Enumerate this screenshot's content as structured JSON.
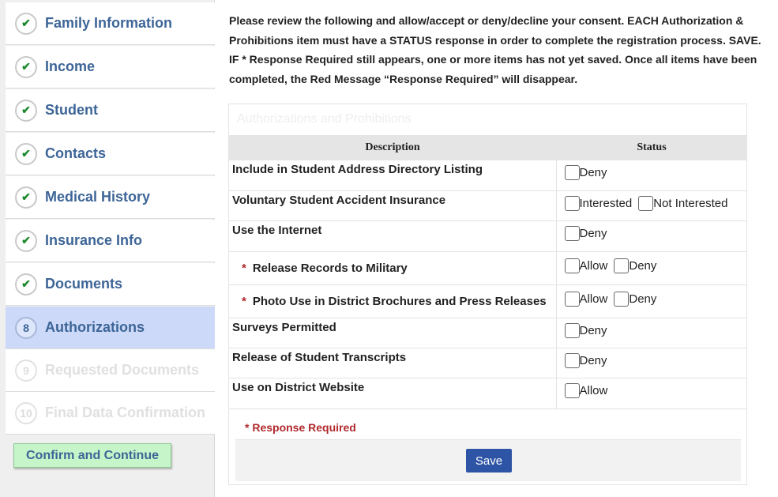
{
  "sidebar": {
    "steps": [
      {
        "marker": "✔",
        "label": "Family Information",
        "state": "complete"
      },
      {
        "marker": "✔",
        "label": "Income",
        "state": "complete"
      },
      {
        "marker": "✔",
        "label": "Student",
        "state": "complete"
      },
      {
        "marker": "✔",
        "label": "Contacts",
        "state": "complete"
      },
      {
        "marker": "✔",
        "label": "Medical History",
        "state": "complete"
      },
      {
        "marker": "✔",
        "label": "Insurance Info",
        "state": "complete"
      },
      {
        "marker": "✔",
        "label": "Documents",
        "state": "complete"
      },
      {
        "marker": "8",
        "label": "Authorizations",
        "state": "active"
      },
      {
        "marker": "9",
        "label": "Requested Documents",
        "state": "disabled"
      },
      {
        "marker": "10",
        "label": "Final Data Confirmation",
        "state": "disabled"
      }
    ],
    "confirm_label": "Confirm and Continue"
  },
  "main": {
    "intro": "Please review the following and allow/accept or deny/decline your consent. EACH Authorization & Prohibitions item must have a STATUS response in order to complete the registration process. SAVE. IF * Response Required still appears, one or more items has not yet saved. Once all items have been completed, the Red Message “Response Required” will disappear.",
    "panel_title": "Authorizations and Prohibitions",
    "table": {
      "headers": {
        "description": "Description",
        "status": "Status"
      },
      "rows": [
        {
          "description": "Include in Student Address Directory Listing",
          "required": false,
          "options": [
            "Deny"
          ]
        },
        {
          "description": "Voluntary Student Accident Insurance",
          "required": false,
          "options": [
            "Interested",
            "Not Interested"
          ]
        },
        {
          "description": "Use the Internet",
          "required": false,
          "options": [
            "Deny"
          ]
        },
        {
          "description": "Release Records to Military",
          "required": true,
          "options": [
            "Allow",
            "Deny"
          ]
        },
        {
          "description": "Photo Use in District Brochures and Press Releases",
          "required": true,
          "options": [
            "Allow",
            "Deny"
          ]
        },
        {
          "description": "Surveys Permitted",
          "required": false,
          "options": [
            "Deny"
          ]
        },
        {
          "description": "Release of Student Transcripts",
          "required": false,
          "options": [
            "Deny"
          ]
        },
        {
          "description": "Use on District Website",
          "required": false,
          "options": [
            "Allow"
          ]
        }
      ]
    },
    "required_marker": "*",
    "footer_note": "* Response Required",
    "save_label": "Save"
  },
  "colors": {
    "link_blue": "#3d6597",
    "active_step": "#ccd9f8",
    "check_green": "#1e8a2e",
    "required_red": "#b0282c",
    "save_button": "#2e54a5",
    "confirm_button": "#c5f5c8"
  }
}
